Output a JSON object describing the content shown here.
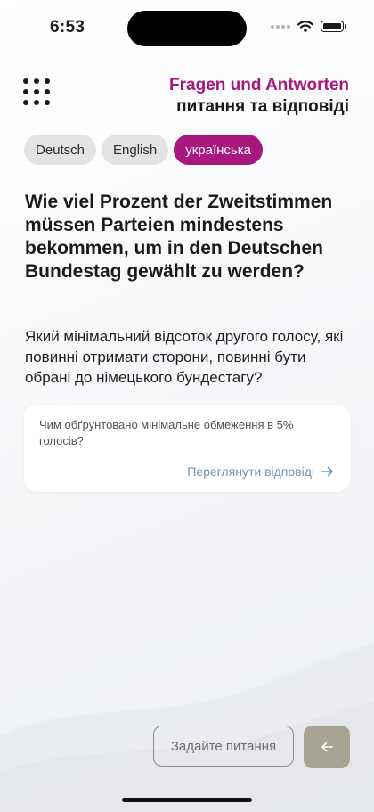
{
  "status_bar": {
    "time": "6:53",
    "icons": [
      "cellular-icon",
      "wifi-icon",
      "battery-icon"
    ]
  },
  "header": {
    "title_de": "Fragen und Antworten",
    "title_uk": "питання та відповіді",
    "menu_icon": "grid-dots-icon"
  },
  "languages": [
    {
      "label": "Deutsch",
      "active": false
    },
    {
      "label": "English",
      "active": false
    },
    {
      "label": "українська",
      "active": true
    }
  ],
  "question": {
    "de": "Wie viel Prozent der Zweitstimmen müssen Parteien mindestens bekommen, um in den Deutschen Bundestag gewählt zu werden?",
    "uk": "Який мінімальний відсоток другого голосу, які повинні отримати сторони, повинні бути обрані до німецького бундестагу?"
  },
  "answer_card": {
    "text": "Чим обґрунтовано мінімальне обмеження в 5% голосів?",
    "link_label": "Переглянути відповіді",
    "link_icon": "arrow-right-icon"
  },
  "footer": {
    "ask_placeholder": "Задайте питання",
    "back_icon": "arrow-left-icon"
  },
  "colors": {
    "accent": "#a8177f",
    "link": "#6a97b8",
    "back_button": "#a7a494"
  }
}
